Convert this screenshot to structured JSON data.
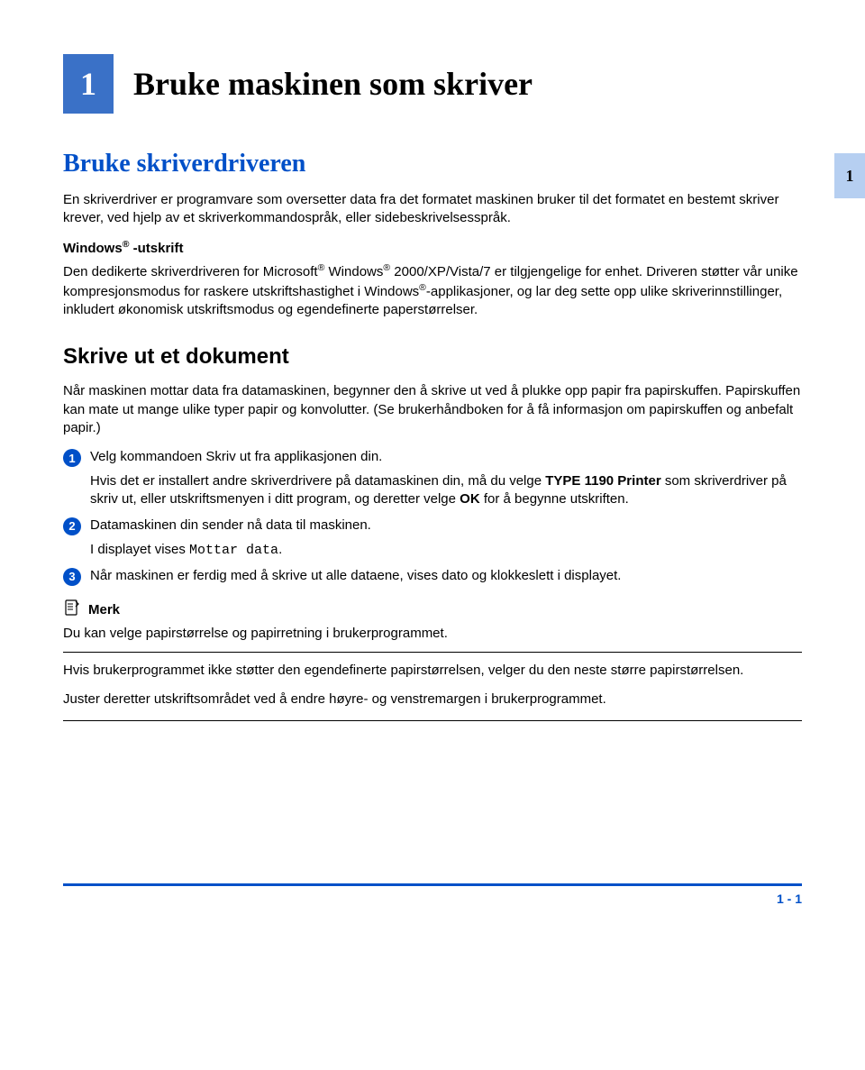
{
  "chapter": {
    "number": "1",
    "title": "Bruke maskinen som skriver",
    "tab": "1"
  },
  "section1": {
    "title": "Bruke skriverdriveren",
    "intro": "En skriverdriver er programvare som oversetter data fra det formatet maskinen bruker til det formatet en bestemt skriver krever, ved hjelp av et skriverkommandospråk, eller sidebeskrivelsesspråk.",
    "subhead_prefix": "Windows",
    "subhead_suffix": " -utskrift",
    "body_a": "Den dedikerte skriverdriveren for Microsoft",
    "body_b": " Windows",
    "body_c": " 2000/XP/Vista/7 er tilgjengelige for enhet. Driveren støtter vår unike kompresjonsmodus for raskere utskriftshastighet i Windows",
    "body_d": "-applikasjoner, og lar deg sette opp ulike skriverinnstillinger, inkludert økonomisk utskriftsmodus og egendefinerte paperstørrelser."
  },
  "section2": {
    "title": "Skrive ut et dokument",
    "intro": "Når maskinen mottar data fra datamaskinen, begynner den å skrive ut ved å plukke opp papir fra papirskuffen. Papirskuffen kan mate ut mange ulike typer papir og konvolutter. (Se brukerhåndboken for å få informasjon om papirskuffen og anbefalt papir.)",
    "step1_a": "Velg kommandoen Skriv ut fra applikasjonen din.",
    "step1_b_pre": "Hvis det er installert andre skriverdrivere på datamaskinen din, må du velge ",
    "step1_b_bold1": "TYPE 1190 Printer",
    "step1_b_mid": " som skriverdriver på skriv ut, eller utskriftsmenyen i ditt program, og deretter velge ",
    "step1_b_bold2": "OK",
    "step1_b_post": " for å begynne utskriften.",
    "step2_a": "Datamaskinen din sender nå data til maskinen.",
    "step2_b_pre": "I displayet vises ",
    "step2_b_mono": "Mottar data",
    "step2_b_post": ".",
    "step3": "Når maskinen er ferdig med å skrive ut alle dataene, vises dato og klokkeslett i displayet."
  },
  "note": {
    "label": "Merk",
    "line1": "Du kan velge papirstørrelse og papirretning i brukerprogrammet.",
    "line2": "Hvis brukerprogrammet ikke støtter den egendefinerte papirstørrelsen, velger du den neste større papirstørrelsen.",
    "line3": "Juster deretter utskriftsområdet ved å endre høyre- og venstremargen i brukerprogrammet."
  },
  "footer": {
    "page": "1 - 1"
  }
}
